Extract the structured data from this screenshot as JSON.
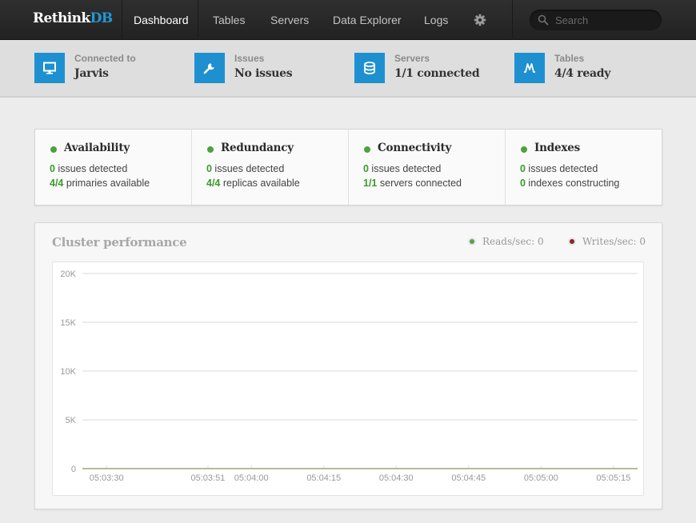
{
  "nav": {
    "brand_main": "Rethink",
    "brand_accent": "DB",
    "items": [
      {
        "label": "Dashboard",
        "active": true
      },
      {
        "label": "Tables",
        "active": false
      },
      {
        "label": "Servers",
        "active": false
      },
      {
        "label": "Data Explorer",
        "active": false
      },
      {
        "label": "Logs",
        "active": false
      }
    ],
    "settings_icon": "gear-icon",
    "search": {
      "placeholder": "Search",
      "value": "",
      "icon": "search-icon"
    }
  },
  "status": [
    {
      "label": "Connected to",
      "value": "Jarvis",
      "icon": "monitor-icon"
    },
    {
      "label": "Issues",
      "value": "No issues",
      "icon": "wrench-icon"
    },
    {
      "label": "Servers",
      "value": "1/1 connected",
      "icon": "database-icon"
    },
    {
      "label": "Tables",
      "value": "4/4 ready",
      "icon": "tables-peak-icon"
    }
  ],
  "health": [
    {
      "title": "Availability",
      "status_color": "#4aa43c",
      "line1": {
        "num": "0",
        "text": " issues detected"
      },
      "line2": {
        "num": "4/4",
        "text": " primaries available"
      }
    },
    {
      "title": "Redundancy",
      "status_color": "#4aa43c",
      "line1": {
        "num": "0",
        "text": " issues detected"
      },
      "line2": {
        "num": "4/4",
        "text": " replicas available"
      }
    },
    {
      "title": "Connectivity",
      "status_color": "#4aa43c",
      "line1": {
        "num": "0",
        "text": " issues detected"
      },
      "line2": {
        "num": "1/1",
        "text": " servers connected"
      }
    },
    {
      "title": "Indexes",
      "status_color": "#4aa43c",
      "line1": {
        "num": "0",
        "text": " issues detected"
      },
      "line2": {
        "num": "0",
        "text": " indexes constructing"
      }
    }
  ],
  "performance": {
    "title": "Cluster performance",
    "legend": [
      {
        "label": "Reads/sec: 0",
        "color": "#5aa14b"
      },
      {
        "label": "Writes/sec: 0",
        "color": "#8a2a22"
      }
    ]
  },
  "colors": {
    "accent": "#1e90d0",
    "ok": "#4aa43c",
    "ok_text": "#3c9a2c"
  },
  "chart_data": {
    "type": "line",
    "title": "Cluster performance",
    "xlabel": "",
    "ylabel": "",
    "ylim": [
      0,
      20000
    ],
    "y_ticks": [
      0,
      5000,
      10000,
      15000,
      20000
    ],
    "y_tick_labels": [
      "0",
      "5K",
      "10K",
      "15K",
      "20K"
    ],
    "x_tick_labels": [
      "05:03:30",
      "05:03:51",
      "05:04:00",
      "05:04:15",
      "05:04:30",
      "05:04:45",
      "05:05:00",
      "05:05:15"
    ],
    "x_tick_seconds": [
      0,
      21,
      30,
      45,
      60,
      75,
      90,
      105
    ],
    "x_range_seconds": [
      -5,
      110
    ],
    "grid": true,
    "legend_position": "top-right",
    "series": [
      {
        "name": "Reads/sec",
        "color": "#5aa14b",
        "values": [
          0,
          0,
          0,
          0,
          0,
          0,
          0,
          0
        ]
      },
      {
        "name": "Writes/sec",
        "color": "#8a2a22",
        "values": [
          0,
          0,
          0,
          0,
          0,
          0,
          0,
          0
        ]
      }
    ]
  }
}
